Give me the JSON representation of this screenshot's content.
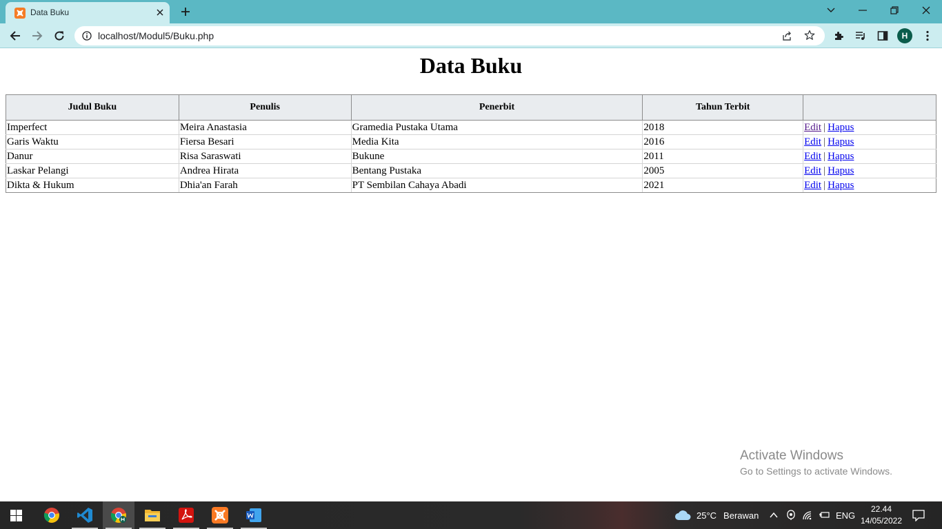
{
  "browser": {
    "tab_title": "Data Buku",
    "url": "localhost/Modul5/Buku.php",
    "profile_initial": "H"
  },
  "page": {
    "title": "Data Buku",
    "table": {
      "headers": [
        "Judul Buku",
        "Penulis",
        "Penerbit",
        "Tahun Terbit",
        ""
      ],
      "edit_label": "Edit",
      "delete_label": "Hapus",
      "separator": "|",
      "rows": [
        {
          "judul": "Imperfect",
          "penulis": "Meira Anastasia",
          "penerbit": "Gramedia Pustaka Utama",
          "tahun": "2018"
        },
        {
          "judul": "Garis Waktu",
          "penulis": "Fiersa Besari",
          "penerbit": "Media Kita",
          "tahun": "2016"
        },
        {
          "judul": "Danur",
          "penulis": "Risa Saraswati",
          "penerbit": "Bukune",
          "tahun": "2011"
        },
        {
          "judul": "Laskar Pelangi",
          "penulis": "Andrea Hirata",
          "penerbit": "Bentang Pustaka",
          "tahun": "2005"
        },
        {
          "judul": "Dikta & Hukum",
          "penulis": "Dhia'an Farah",
          "penerbit": "PT Sembilan Cahaya Abadi",
          "tahun": "2021"
        }
      ]
    }
  },
  "watermark": {
    "title": "Activate Windows",
    "subtitle": "Go to Settings to activate Windows."
  },
  "taskbar": {
    "weather_temp": "25°C",
    "weather_desc": "Berawan",
    "language": "ENG",
    "time": "22.44",
    "date": "14/05/2022"
  },
  "colors": {
    "tabstrip": "#5bb8c4",
    "toolbar": "#ccedf0",
    "link": "#0000ee",
    "visited_link": "#551a8b",
    "header_bg": "#e9ecef"
  }
}
